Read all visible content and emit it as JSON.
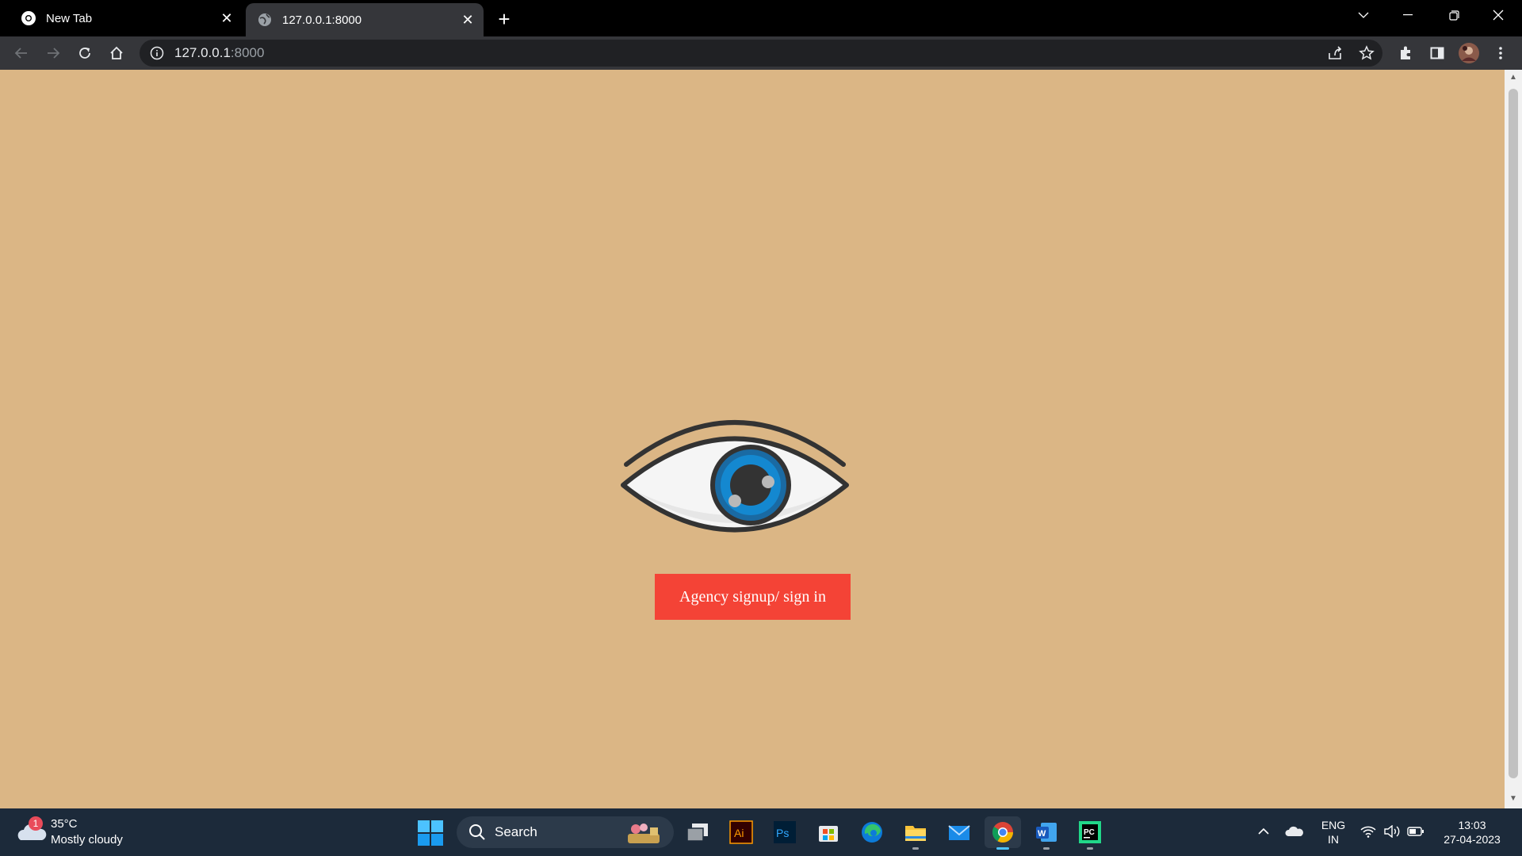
{
  "browser": {
    "tabs": [
      {
        "title": "New Tab",
        "active": false
      },
      {
        "title": "127.0.0.1:8000",
        "active": true
      }
    ],
    "address": {
      "host": "127.0.0.1",
      "port": ":8000"
    }
  },
  "page": {
    "background_color": "#dbb685",
    "eye_icon": "eye-icon",
    "button_label": "Agency signup/ sign in",
    "button_color": "#f44336"
  },
  "taskbar": {
    "weather": {
      "badge": "1",
      "temperature": "35°C",
      "condition": "Mostly cloudy"
    },
    "search_label": "Search",
    "apps": [
      "task-view",
      "adobe-illustrator",
      "adobe-photoshop",
      "microsoft-store",
      "edge",
      "file-explorer",
      "mail",
      "chrome",
      "word",
      "pycharm"
    ],
    "language": {
      "line1": "ENG",
      "line2": "IN"
    },
    "clock": {
      "time": "13:03",
      "date": "27-04-2023"
    }
  }
}
